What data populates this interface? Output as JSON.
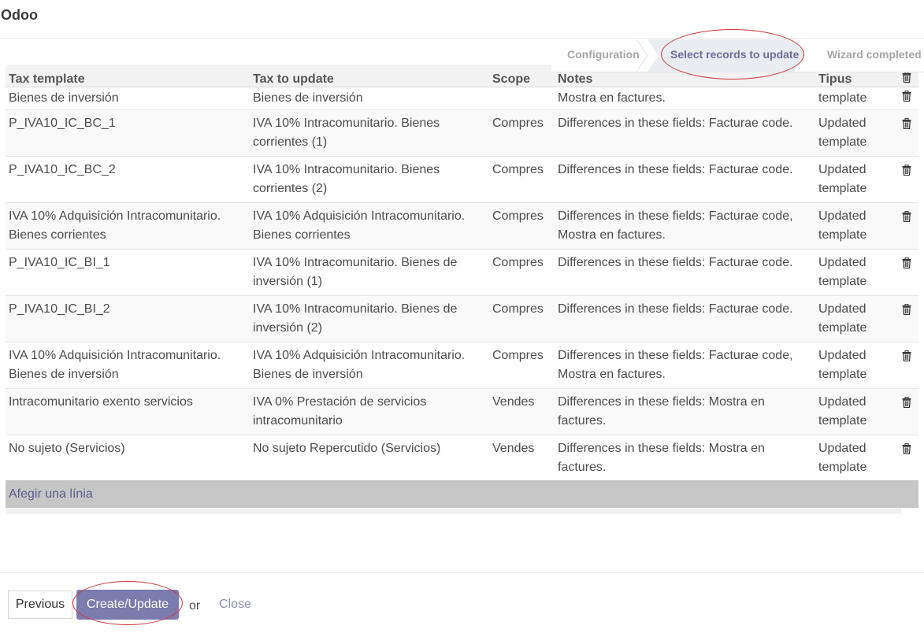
{
  "app": {
    "title": "Odoo"
  },
  "statusbar": {
    "steps": [
      "Configuration",
      "Select records to update",
      "Wizard completed"
    ]
  },
  "table": {
    "headers": [
      "Tax template",
      "Tax to update",
      "Scope",
      "Notes",
      "Tipus"
    ],
    "rows": [
      {
        "tax_template": "Bienes de inversión",
        "tax_to_update": "Bienes de inversión",
        "scope": "",
        "notes": "Mostra en factures.",
        "type": "template"
      },
      {
        "tax_template": "P_IVA10_IC_BC_1",
        "tax_to_update": "IVA 10% Intracomunitario. Bienes corrientes (1)",
        "scope": "Compres",
        "notes": "Differences in these fields: Facturae code.",
        "type": "Updated template"
      },
      {
        "tax_template": "P_IVA10_IC_BC_2",
        "tax_to_update": "IVA 10% Intracomunitario. Bienes corrientes (2)",
        "scope": "Compres",
        "notes": "Differences in these fields: Facturae code.",
        "type": "Updated template"
      },
      {
        "tax_template": "IVA 10% Adquisición Intracomunitario. Bienes corrientes",
        "tax_to_update": "IVA 10% Adquisición Intracomunitario. Bienes corrientes",
        "scope": "Compres",
        "notes": "Differences in these fields: Facturae code, Mostra en factures.",
        "type": "Updated template"
      },
      {
        "tax_template": "P_IVA10_IC_BI_1",
        "tax_to_update": "IVA 10% Intracomunitario. Bienes de inversión (1)",
        "scope": "Compres",
        "notes": "Differences in these fields: Facturae code.",
        "type": "Updated template"
      },
      {
        "tax_template": "P_IVA10_IC_BI_2",
        "tax_to_update": "IVA 10% Intracomunitario. Bienes de inversión (2)",
        "scope": "Compres",
        "notes": "Differences in these fields: Facturae code.",
        "type": "Updated template"
      },
      {
        "tax_template": "IVA 10% Adquisición Intracomunitario. Bienes de inversión",
        "tax_to_update": "IVA 10% Adquisición Intracomunitario. Bienes de inversión",
        "scope": "Compres",
        "notes": "Differences in these fields: Facturae code, Mostra en factures.",
        "type": "Updated template"
      },
      {
        "tax_template": "Intracomunitario exento servicios",
        "tax_to_update": "IVA 0% Prestación de servicios intracomunitario",
        "scope": "Vendes",
        "notes": "Differences in these fields: Mostra en factures.",
        "type": "Updated template"
      },
      {
        "tax_template": "No sujeto (Servicios)",
        "tax_to_update": "No sujeto Repercutido (Servicios)",
        "scope": "Vendes",
        "notes": "Differences in these fields: Mostra en factures.",
        "type": "Updated template"
      }
    ],
    "add_line_label": "Afegir una línia"
  },
  "footer": {
    "previous_label": "Previous",
    "create_update_label": "Create/Update",
    "or_label": "or",
    "close_label": "Close"
  },
  "icons": {
    "row_delete": "trash-icon"
  },
  "colors": {
    "primary": "#7c7bad",
    "annotation": "#d0363b"
  }
}
